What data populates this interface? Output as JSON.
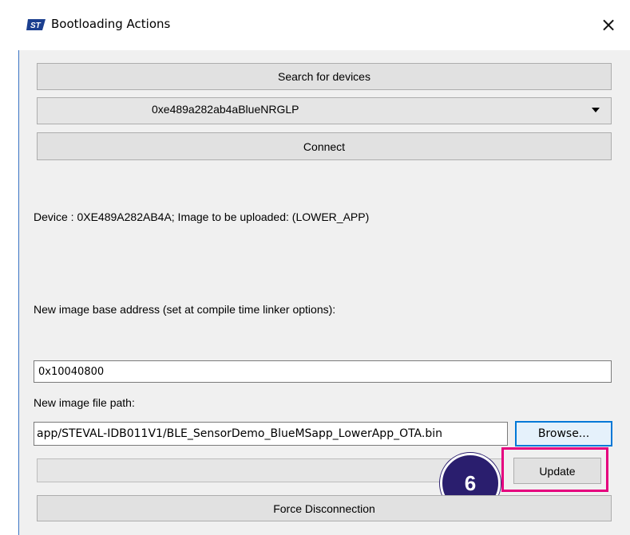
{
  "window": {
    "title": "Bootloading Actions",
    "logo_icon": "st-logo-icon",
    "close_glyph": "×"
  },
  "controls": {
    "search_button": "Search for devices",
    "device_select": {
      "selected": "0xe489a282ab4aBlueNRGLP"
    },
    "connect_button": "Connect",
    "device_info": "Device : 0XE489A282AB4A; Image to be uploaded: (LOWER_APP)",
    "base_address_label": "New image base address (set at compile time linker options):",
    "base_address_value": "0x10040800",
    "file_path_label": "New image file path:",
    "file_path_value": "app/STEVAL-IDB011V1/BLE_SensorDemo_BlueMSapp_LowerApp_OTA.bin",
    "browse_button": "Browse...",
    "update_button": "Update",
    "force_disconnect_button": "Force Disconnection"
  },
  "annotation": {
    "step_badge": "6",
    "highlight_color": "#e5007e",
    "badge_color": "#2a1e6e"
  }
}
